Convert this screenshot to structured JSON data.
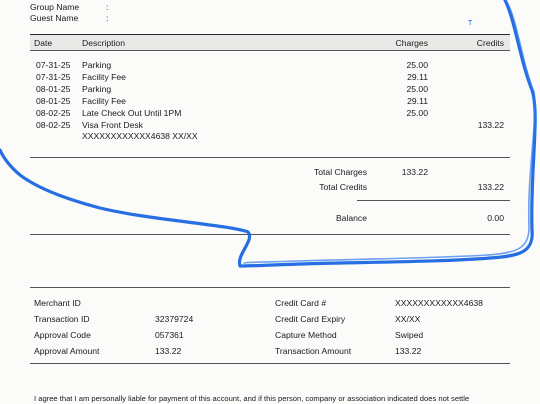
{
  "guest_info": {
    "group_name_label": "Group Name",
    "group_name_sep": ":",
    "guest_name_label": "Guest Name",
    "guest_name_sep": ":"
  },
  "stray_mark": "T",
  "table": {
    "headers": {
      "date": "Date",
      "description": "Description",
      "charges": "Charges",
      "credits": "Credits"
    },
    "rows": [
      {
        "date": "07-31-25",
        "description": "Parking",
        "charges": "25.00",
        "credits": ""
      },
      {
        "date": "07-31-25",
        "description": "Facility Fee",
        "charges": "29.11",
        "credits": ""
      },
      {
        "date": "08-01-25",
        "description": "Parking",
        "charges": "25.00",
        "credits": ""
      },
      {
        "date": "08-01-25",
        "description": "Facility Fee",
        "charges": "29.11",
        "credits": ""
      },
      {
        "date": "08-02-25",
        "description": "Late Check Out Until 1PM",
        "charges": "25.00",
        "credits": ""
      },
      {
        "date": "08-02-25",
        "description": "Visa Front Desk",
        "charges": "",
        "credits": "133.22"
      }
    ],
    "card_line": "XXXXXXXXXXXX4638 XX/XX"
  },
  "totals": {
    "total_charges_label": "Total Charges",
    "total_charges_value": "133.22",
    "total_credits_label": "Total Credits",
    "total_credits_value": "133.22",
    "balance_label": "Balance",
    "balance_value": "0.00"
  },
  "payment": {
    "merchant_id_label": "Merchant ID",
    "merchant_id_value": "",
    "transaction_id_label": "Transaction ID",
    "transaction_id_value": "32379724",
    "approval_code_label": "Approval Code",
    "approval_code_value": "057361",
    "approval_amount_label": "Approval Amount",
    "approval_amount_value": "133.22",
    "credit_card_label": "Credit Card #",
    "credit_card_value": "XXXXXXXXXXXX4638",
    "card_expiry_label": "Credit Card Expiry",
    "card_expiry_value": "XX/XX",
    "capture_method_label": "Capture Method",
    "capture_method_value": "Swiped",
    "transaction_amount_label": "Transaction Amount",
    "transaction_amount_value": "133.22"
  },
  "footer": {
    "agreement_text": "I agree that I am personally liable for payment of this account, and if this person, company or association indicated does not settle"
  },
  "colors": {
    "scribble": "#1a66e0",
    "rule": "#2a2a2a"
  }
}
